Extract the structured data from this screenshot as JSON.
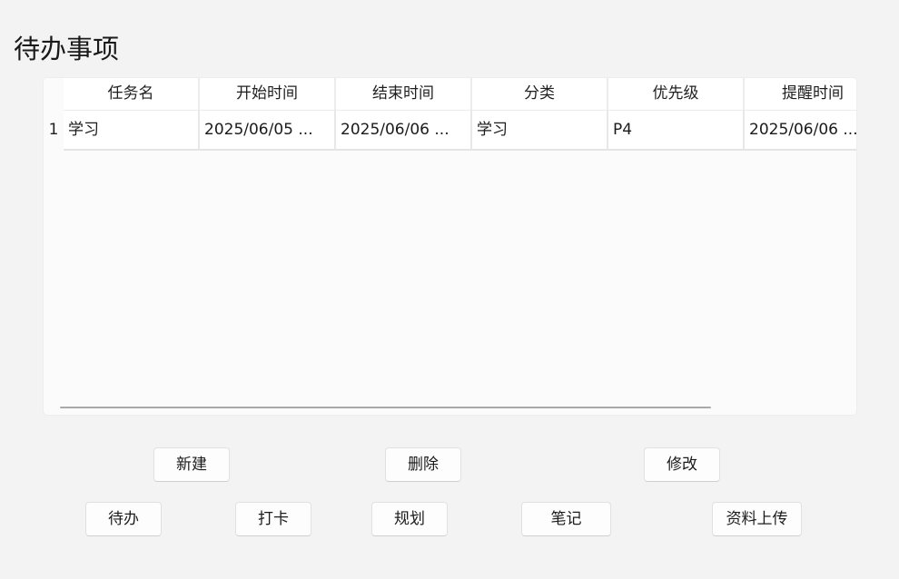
{
  "page": {
    "title": "待办事项"
  },
  "table": {
    "columns": [
      "任务名",
      "开始时间",
      "结束时间",
      "分类",
      "优先级",
      "提醒时间"
    ],
    "rows": [
      {
        "index": "1",
        "cells": [
          "学习",
          "2025/06/05 ...",
          "2025/06/06 ...",
          "学习",
          "P4",
          "2025/06/06 ..."
        ]
      }
    ]
  },
  "actions": {
    "new_label": "新建",
    "delete_label": "删除",
    "edit_label": "修改"
  },
  "nav": {
    "todo_label": "待办",
    "checkin_label": "打卡",
    "plan_label": "规划",
    "notes_label": "笔记",
    "upload_label": "资料上传"
  }
}
